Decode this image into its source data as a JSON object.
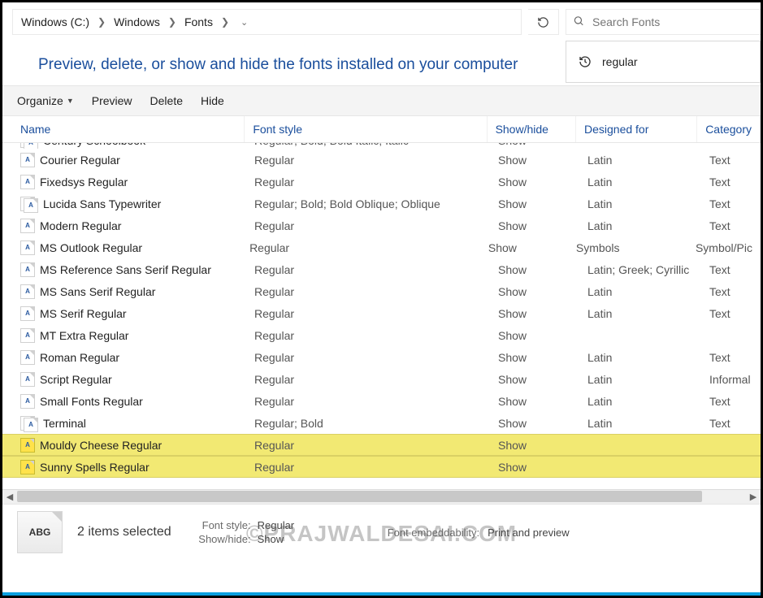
{
  "breadcrumbs": [
    "Windows (C:)",
    "Windows",
    "Fonts"
  ],
  "search": {
    "placeholder": "Search Fonts",
    "history_item": "regular"
  },
  "heading": "Preview, delete, or show and hide the fonts installed on your computer",
  "toolbar": {
    "organize": "Organize",
    "preview": "Preview",
    "delete": "Delete",
    "hide": "Hide"
  },
  "columns": {
    "name": "Name",
    "style": "Font style",
    "showhide": "Show/hide",
    "designed": "Designed for",
    "category": "Category"
  },
  "rows": [
    {
      "name": "Century Schoolbook",
      "style": "Regular; Bold; Bold Italic; Italic",
      "show": "Show",
      "designed": "",
      "category": "",
      "cut": true,
      "stack": true
    },
    {
      "name": "Courier Regular",
      "style": "Regular",
      "show": "Show",
      "designed": "Latin",
      "category": "Text"
    },
    {
      "name": "Fixedsys Regular",
      "style": "Regular",
      "show": "Show",
      "designed": "Latin",
      "category": "Text"
    },
    {
      "name": "Lucida Sans Typewriter",
      "style": "Regular; Bold; Bold Oblique; Oblique",
      "show": "Show",
      "designed": "Latin",
      "category": "Text",
      "stack": true
    },
    {
      "name": "Modern Regular",
      "style": "Regular",
      "show": "Show",
      "designed": "Latin",
      "category": "Text"
    },
    {
      "name": "MS Outlook Regular",
      "style": "Regular",
      "show": "Show",
      "designed": "Symbols",
      "category": "Symbol/Pic"
    },
    {
      "name": "MS Reference Sans Serif Regular",
      "style": "Regular",
      "show": "Show",
      "designed": "Latin; Greek; Cyrillic",
      "category": "Text"
    },
    {
      "name": "MS Sans Serif Regular",
      "style": "Regular",
      "show": "Show",
      "designed": "Latin",
      "category": "Text"
    },
    {
      "name": "MS Serif Regular",
      "style": "Regular",
      "show": "Show",
      "designed": "Latin",
      "category": "Text"
    },
    {
      "name": "MT Extra Regular",
      "style": "Regular",
      "show": "Show",
      "designed": "",
      "category": ""
    },
    {
      "name": "Roman Regular",
      "style": "Regular",
      "show": "Show",
      "designed": "Latin",
      "category": "Text"
    },
    {
      "name": "Script Regular",
      "style": "Regular",
      "show": "Show",
      "designed": "Latin",
      "category": "Informal"
    },
    {
      "name": "Small Fonts Regular",
      "style": "Regular",
      "show": "Show",
      "designed": "Latin",
      "category": "Text"
    },
    {
      "name": "Terminal",
      "style": "Regular; Bold",
      "show": "Show",
      "designed": "Latin",
      "category": "Text",
      "stack": true
    },
    {
      "name": "Mouldy Cheese Regular",
      "style": "Regular",
      "show": "Show",
      "designed": "",
      "category": "",
      "highlight": true
    },
    {
      "name": "Sunny Spells Regular",
      "style": "Regular",
      "show": "Show",
      "designed": "",
      "category": "",
      "highlight": true
    }
  ],
  "details": {
    "thumb_label": "ABG",
    "selection": "2 items selected",
    "fontstyle_k": "Font style:",
    "fontstyle_v": "Regular",
    "showhide_k": "Show/hide:",
    "showhide_v": "Show",
    "embed_k": "Font embeddability:",
    "embed_v": "Print and preview"
  },
  "watermark": "©PRAJWALDESAI.COM"
}
